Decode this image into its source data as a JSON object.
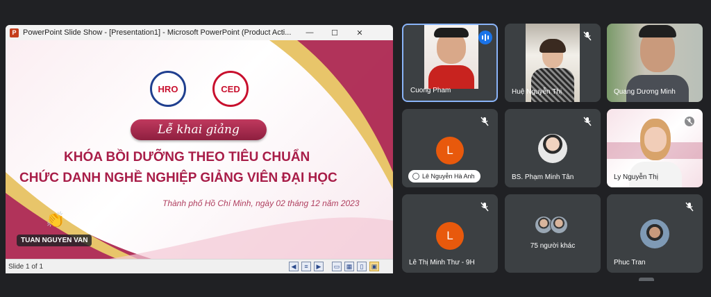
{
  "ppt": {
    "window_title": "PowerPoint Slide Show - [Presentation1] - Microsoft PowerPoint (Product Acti...",
    "app_icon": "P",
    "window_controls": {
      "minimize": "—",
      "maximize": "☐",
      "close": "✕"
    },
    "status_text": "Slide 1 of 1",
    "slide": {
      "logo_left_text": "HRO",
      "logo_right_text": "CED",
      "banner": "Lễ khai giảng",
      "heading_line1": "KHÓA BỒI DƯỠNG THEO TIÊU CHUẨN",
      "heading_line2": "CHỨC DANH NGHỀ NGHIỆP GIẢNG VIÊN ĐẠI HỌC",
      "date_line": "Thành phố Hồ Chí Minh, ngày 02 tháng 12 năm 2023",
      "reaction": "👏",
      "presenter_name": "TUAN NGUYEN VAN"
    }
  },
  "participants": [
    {
      "name": "Cuong Pham",
      "speaking": true
    },
    {
      "name": "Huệ Nguyễn Thị",
      "muted": true
    },
    {
      "name": "Quang Dương Minh"
    },
    {
      "avatar_letter": "L",
      "name": "Lê Nguyễn Hà Anh",
      "muted": true
    },
    {
      "name": "BS. Phạm Minh Tân",
      "muted": true
    },
    {
      "name": "Ly Nguyễn Thị",
      "muted": true
    },
    {
      "avatar_letter": "L",
      "name": "Lê Thị Minh Thư - 9H",
      "muted": true
    },
    {
      "name": "75 người khác"
    },
    {
      "name": "Phuc Tran",
      "muted": true
    }
  ],
  "colors": {
    "background": "#202124",
    "tile": "#3c4043",
    "speaking_border": "#8ab4f8",
    "avatar_orange": "#e8590c",
    "slide_accent": "#a81d48",
    "gold": "#e8c56a"
  }
}
